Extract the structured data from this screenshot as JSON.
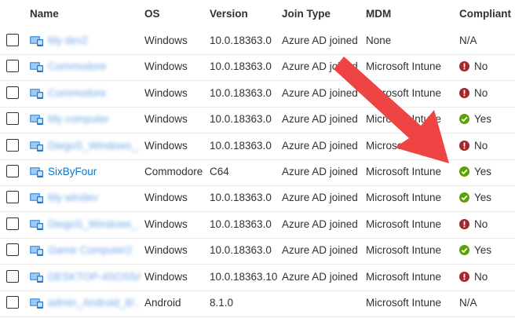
{
  "columns": {
    "name": "Name",
    "os": "OS",
    "version": "Version",
    "join_type": "Join Type",
    "mdm": "MDM",
    "compliant": "Compliant"
  },
  "rows": [
    {
      "name": "My dev2",
      "name_obscured": true,
      "os": "Windows",
      "version": "10.0.18363.0",
      "join_type": "Azure AD joined",
      "mdm": "None",
      "compliant": "N/A",
      "status": "na"
    },
    {
      "name": "Commodore",
      "name_obscured": true,
      "os": "Windows",
      "version": "10.0.18363.0",
      "join_type": "Azure AD joined",
      "mdm": "Microsoft Intune",
      "compliant": "No",
      "status": "no"
    },
    {
      "name": "Commodore",
      "name_obscured": true,
      "os": "Windows",
      "version": "10.0.18363.0",
      "join_type": "Azure AD joined",
      "mdm": "Microsoft Intune",
      "compliant": "No",
      "status": "no"
    },
    {
      "name": "My computer",
      "name_obscured": true,
      "os": "Windows",
      "version": "10.0.18363.0",
      "join_type": "Azure AD joined",
      "mdm": "Microsoft Intune",
      "compliant": "Yes",
      "status": "yes"
    },
    {
      "name": "DiegoS_Windows_...",
      "name_obscured": true,
      "os": "Windows",
      "version": "10.0.18363.0",
      "join_type": "Azure AD joined",
      "mdm": "Microsoft Intune",
      "compliant": "No",
      "status": "no"
    },
    {
      "name": "SixByFour",
      "name_obscured": false,
      "os": "Commodore",
      "version": "C64",
      "join_type": "Azure AD joined",
      "mdm": "Microsoft Intune",
      "compliant": "Yes",
      "status": "yes"
    },
    {
      "name": "My windev",
      "name_obscured": true,
      "os": "Windows",
      "version": "10.0.18363.0",
      "join_type": "Azure AD joined",
      "mdm": "Microsoft Intune",
      "compliant": "Yes",
      "status": "yes"
    },
    {
      "name": "DiegoS_Windows_...",
      "name_obscured": true,
      "os": "Windows",
      "version": "10.0.18363.0",
      "join_type": "Azure AD joined",
      "mdm": "Microsoft Intune",
      "compliant": "No",
      "status": "no"
    },
    {
      "name": "Game Computer2",
      "name_obscured": true,
      "os": "Windows",
      "version": "10.0.18363.0",
      "join_type": "Azure AD joined",
      "mdm": "Microsoft Intune",
      "compliant": "Yes",
      "status": "yes"
    },
    {
      "name": "DESKTOP-4SOS5A7",
      "name_obscured": true,
      "os": "Windows",
      "version": "10.0.18363.10",
      "join_type": "Azure AD joined",
      "mdm": "Microsoft Intune",
      "compliant": "No",
      "status": "no"
    },
    {
      "name": "admin_Android_8/...",
      "name_obscured": true,
      "os": "Android",
      "version": "8.1.0",
      "join_type": "",
      "mdm": "Microsoft Intune",
      "compliant": "N/A",
      "status": "na"
    }
  ],
  "colors": {
    "link": "#0078d4",
    "status_no": "#a4262c",
    "status_yes": "#57a300",
    "arrow": "#ef4444"
  },
  "icons": {
    "device": "monitor-icon",
    "status_no": "exclamation-circle-icon",
    "status_yes": "check-circle-icon"
  }
}
